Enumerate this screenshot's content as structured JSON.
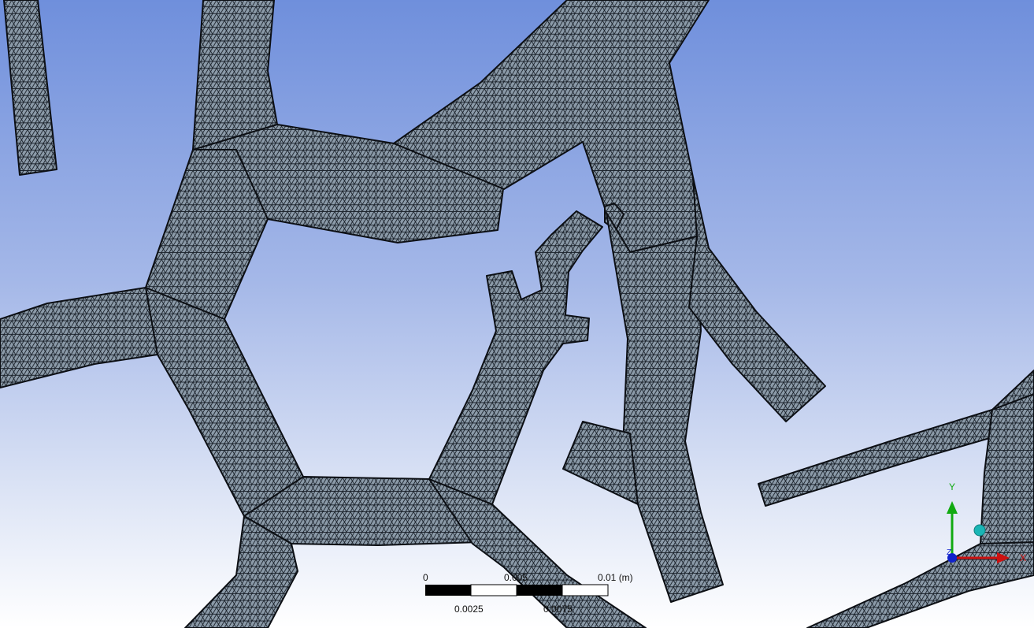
{
  "viewport": {
    "background_top": "#6f8fdc",
    "background_bottom": "#ffffff",
    "mesh_fill": "#8a98a6",
    "mesh_line": "#1a2028",
    "outline": "#0c0f14"
  },
  "scale_bar": {
    "label_zero": "0",
    "label_005": "0.005",
    "label_01": "0.01 (m)",
    "label_0025": "0.0025",
    "label_0075": "0.0075"
  },
  "triad": {
    "x_label": "X",
    "y_label": "Y",
    "z_label": "Z",
    "x_color": "#cc1111",
    "y_color": "#11aa11",
    "z_color": "#1122cc",
    "iso_ball_color": "#19b5b5"
  }
}
